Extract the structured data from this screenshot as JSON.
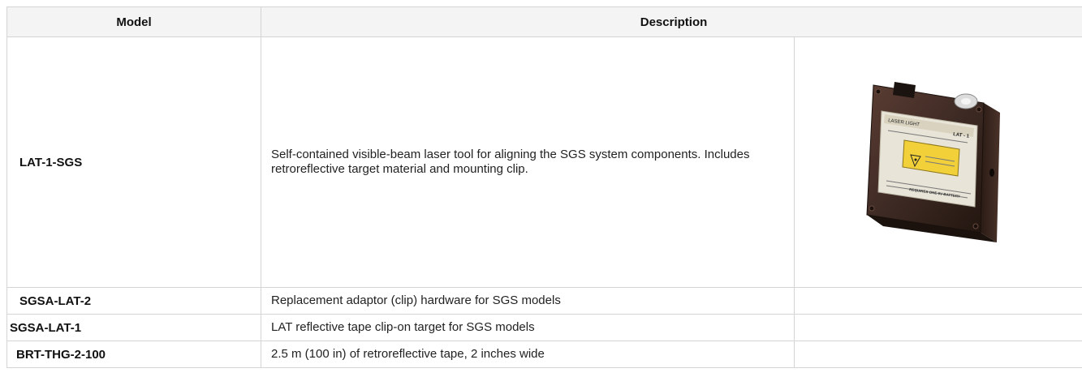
{
  "table": {
    "headers": {
      "model": "Model",
      "description": "Description"
    },
    "rows": [
      {
        "model": "LAT-1-SGS",
        "description": "Self-contained visible-beam laser tool for aligning the SGS system components. Includes retroreflective target material and mounting clip.",
        "image": {
          "label_lines": [
            "LASER LIGHT",
            "LAT - 1",
            "REQUIRES ONE 9V BATTERY"
          ]
        }
      },
      {
        "model": "SGSA-LAT-2",
        "description": "Replacement adaptor (clip) hardware for SGS models"
      },
      {
        "model": "SGSA-LAT-1",
        "description": "LAT reflective tape clip-on target for SGS models"
      },
      {
        "model": "BRT-THG-2-100",
        "description": "2.5 m (100 in) of retroreflective tape, 2 inches wide"
      }
    ]
  }
}
